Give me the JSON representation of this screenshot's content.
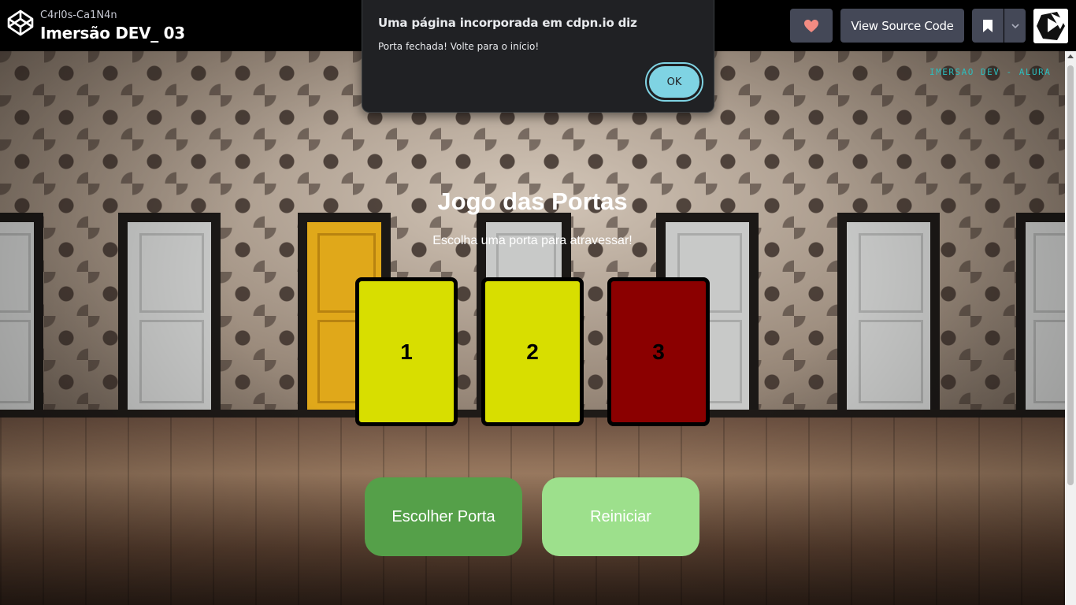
{
  "header": {
    "author": "C4rl0s-Ca1N4n",
    "pen_title": "Imersão DEV_ 03",
    "source_label": "View Source Code",
    "icons": {
      "logo": "codepen-logo-icon",
      "heart": "heart-icon",
      "bookmark": "bookmark-icon",
      "dropdown": "chevron-down-icon"
    },
    "heart_color": "#f28b82"
  },
  "game": {
    "credit": "IMERSAO DEV - ALURA",
    "title": "Jogo das Portas",
    "subtitle": "Escolha uma porta para atravessar!",
    "doors": [
      {
        "label": "1",
        "color": "#d8de00"
      },
      {
        "label": "2",
        "color": "#d8de00"
      },
      {
        "label": "3",
        "color": "#8b0000"
      }
    ],
    "choose_label": "Escolher Porta",
    "choose_color": "#55a049",
    "restart_label": "Reiniciar",
    "restart_color": "#9de08c"
  },
  "alert": {
    "title": "Uma página incorporada em cdpn.io diz",
    "message": "Porta fechada! Volte para o início!",
    "ok_label": "OK"
  }
}
